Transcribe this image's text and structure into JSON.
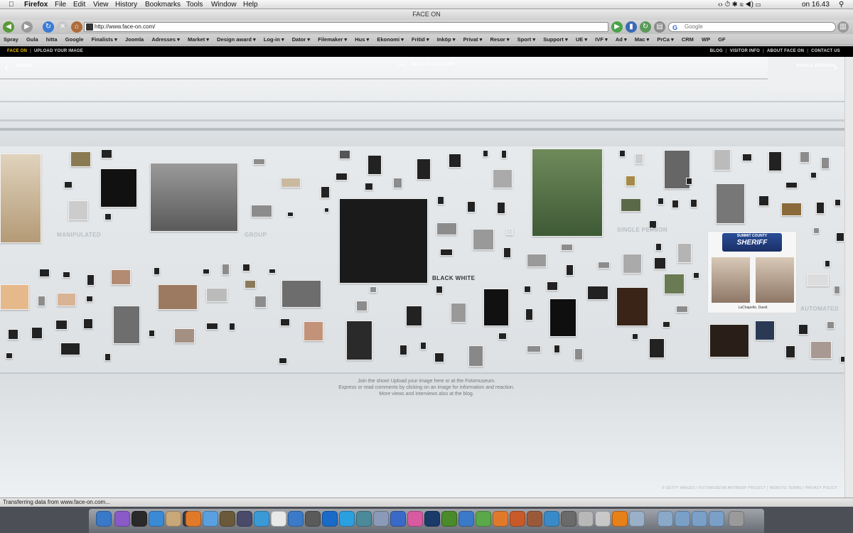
{
  "menubar": {
    "app": "Firefox",
    "items": [
      "File",
      "Edit",
      "View",
      "History",
      "Bookmarks",
      "Tools",
      "Window",
      "Help"
    ],
    "clock": "on 16.43"
  },
  "window": {
    "title": "FACE ON"
  },
  "toolbar": {
    "url": "http://www.face-on.com/",
    "search_placeholder": "Google"
  },
  "bookmarks": [
    "Spray",
    "Gula",
    "hitta",
    "Google",
    "Finalists ▾",
    "Joomla",
    "Adresses ▾",
    "Market ▾",
    "Design award ▾",
    "Log-in ▾",
    "Dator ▾",
    "Filemaker ▾",
    "Hus ▾",
    "Ekonomi ▾",
    "Fritid ▾",
    "Inköp ▾",
    "Privat ▾",
    "Resor ▾",
    "Sport ▾",
    "Support ▾",
    "UE ▾",
    "IVF ▾",
    "Ad ▾",
    "Mac ▾",
    "PrCa ▾",
    "CRM",
    "WP",
    "GF"
  ],
  "sitenav": {
    "brand": "FACE ON",
    "upload": "UPLOAD YOUR IMAGE",
    "links": [
      "BLOG",
      "VISITOR INFO",
      "ABOUT FACE ON",
      "CONTACT US"
    ]
  },
  "gallery": {
    "prev": "GROUP",
    "back": "BACK TO GALLERY",
    "next": "SINGLE PERSON",
    "categories": {
      "manipulated": "MANIPULATED",
      "group": "GROUP",
      "black_white": "BLACK WHITE",
      "single_person": "SINGLE PERSON",
      "automated": "AUTOMATED"
    },
    "sheriff": {
      "line1": "SUMMIT COUNTY",
      "line2": "SHERIFF",
      "caption": "LaChapelle, David"
    },
    "join_lines": [
      "Join the show! Upload your image here or at the Fotomuseum.",
      "Express or read comments by clicking on an image for information and reaction.",
      "More views and interviews also at the blog."
    ],
    "legal": "© GETTY IMAGES / FOTOMUSEUM ANTWERP PROJECT | WEBSITE TERMS | PRIVACY POLICY"
  },
  "status": "Transferring data from www.face-on.com..."
}
